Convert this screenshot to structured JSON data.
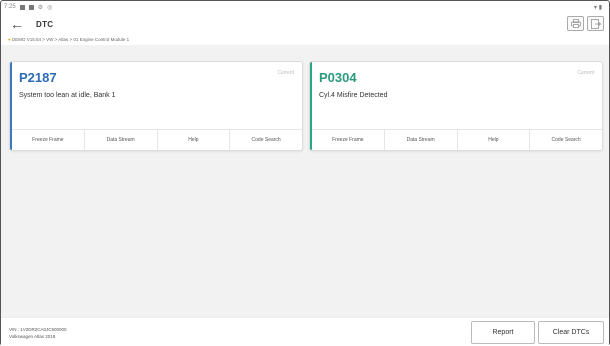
{
  "status_bar": {
    "time": "7:25",
    "signal": "▾ ▮"
  },
  "header": {
    "title": "DTC"
  },
  "breadcrumb": "DEMO V15.54 > VW > Atlas > 01 Engine Control Module 1",
  "colors": {
    "card1_accent": "#3a78c2",
    "card2_accent": "#2aa58a",
    "card1_code": "#2e6bb5",
    "card2_code": "#2a9a80"
  },
  "dtcs": [
    {
      "code": "P2187",
      "status": "Current",
      "description": "System too lean at idle, Bank 1",
      "actions": [
        "Freeze Frame",
        "Data Stream",
        "Help",
        "Code Search"
      ]
    },
    {
      "code": "P0304",
      "status": "Current",
      "description": "Cyl.4 Misfire Detected",
      "actions": [
        "Freeze Frame",
        "Data Stream",
        "Help",
        "Code Search"
      ]
    }
  ],
  "footer": {
    "vin": "VIN : 1V2DR2CA0JC500000",
    "vehicle": "Volkswagen Atlas 2018",
    "report_label": "Report",
    "clear_label": "Clear DTCs"
  },
  "icons": {
    "back": "back-arrow-icon",
    "print": "print-icon",
    "exit": "exit-icon"
  }
}
